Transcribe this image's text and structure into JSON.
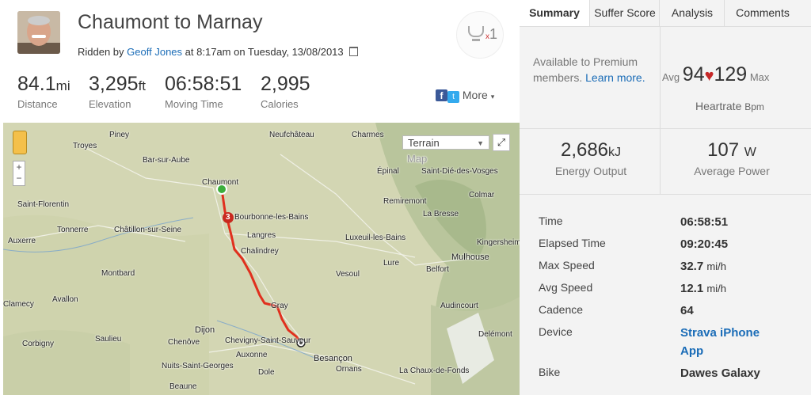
{
  "activity": {
    "title": "Chaumont to Marnay",
    "ridden_by_prefix": "Ridden by",
    "athlete": "Geoff Jones",
    "date_text": "at 8:17am on Tuesday, 13/08/2013",
    "trophy_prefix": "x",
    "trophy_count": "1"
  },
  "stats": [
    {
      "value": "84.1",
      "unit": "mi",
      "label": "Distance"
    },
    {
      "value": "3,295",
      "unit": "ft",
      "label": "Elevation"
    },
    {
      "value": "06:58:51",
      "unit": "",
      "label": "Moving Time"
    },
    {
      "value": "2,995",
      "unit": "",
      "label": "Calories"
    }
  ],
  "share": {
    "facebook": "f",
    "twitter": "t",
    "more_label": "More",
    "caret": "▾"
  },
  "map": {
    "map_type": "Terrain",
    "watermark": "Map",
    "fullscreen": "⤢",
    "zoom_in": "+",
    "zoom_out": "−",
    "marker_number": "3",
    "places": [
      {
        "name": "Piney"
      },
      {
        "name": "Neufchâteau"
      },
      {
        "name": "Charmes"
      },
      {
        "name": "Troyes"
      },
      {
        "name": "Bar-sur-Aube"
      },
      {
        "name": "Chaumont"
      },
      {
        "name": "Épinal"
      },
      {
        "name": "Saint-Dié-des-Vosges"
      },
      {
        "name": "Saint-Florentin"
      },
      {
        "name": "Bourbonne-les-Bains"
      },
      {
        "name": "Remiremont"
      },
      {
        "name": "Colmar"
      },
      {
        "name": "Tonnerre"
      },
      {
        "name": "Châtillon-sur-Seine"
      },
      {
        "name": "La Bresse"
      },
      {
        "name": "Langres"
      },
      {
        "name": "Luxeuil-les-Bains"
      },
      {
        "name": "Kingersheim"
      },
      {
        "name": "Auxerre"
      },
      {
        "name": "Chalindrey"
      },
      {
        "name": "Mulhouse"
      },
      {
        "name": "Montbard"
      },
      {
        "name": "Lure"
      },
      {
        "name": "Belfort"
      },
      {
        "name": "Vesoul"
      },
      {
        "name": "Avallon"
      },
      {
        "name": "Clamecy"
      },
      {
        "name": "Gray"
      },
      {
        "name": "Audincourt"
      },
      {
        "name": "Dijon"
      },
      {
        "name": "Saulieu"
      },
      {
        "name": "Chenôve"
      },
      {
        "name": "Corbigny"
      },
      {
        "name": "Chevigny-Saint-Sauveur"
      },
      {
        "name": "Delémont"
      },
      {
        "name": "Auxonne"
      },
      {
        "name": "Nuits-Saint-Georges"
      },
      {
        "name": "Besançon"
      },
      {
        "name": "Ornans"
      },
      {
        "name": "Dole"
      },
      {
        "name": "La Chaux-de-Fonds"
      },
      {
        "name": "Beaune"
      }
    ]
  },
  "tabs": [
    {
      "label": "Summary",
      "active": true
    },
    {
      "label": "Suffer Score",
      "active": false
    },
    {
      "label": "Analysis",
      "active": false
    },
    {
      "label": "Comments",
      "active": false
    }
  ],
  "premium": {
    "line1": "Available to Premium",
    "line2": "members.",
    "link": "Learn more."
  },
  "heartrate": {
    "avg_label": "Avg",
    "avg": "94",
    "max": "129",
    "max_label": "Max",
    "heart": "♥",
    "label": "Heartrate",
    "unit": "Bpm"
  },
  "energy": {
    "value": "2,686",
    "unit": "kJ",
    "label": "Energy Output"
  },
  "power": {
    "value": "107",
    "unit": "W",
    "label": "Average Power"
  },
  "details": [
    {
      "label": "Time",
      "value": "06:58:51",
      "unit": ""
    },
    {
      "label": "Elapsed Time",
      "value": "09:20:45",
      "unit": ""
    },
    {
      "label": "Max Speed",
      "value": "32.7",
      "unit": "mi/h"
    },
    {
      "label": "Avg Speed",
      "value": "12.1",
      "unit": "mi/h"
    },
    {
      "label": "Cadence",
      "value": "64",
      "unit": ""
    },
    {
      "label": "Device",
      "value": "Strava iPhone App",
      "unit": ""
    },
    {
      "label": "Bike",
      "value": "Dawes Galaxy",
      "unit": ""
    }
  ],
  "colors": {
    "route": "#e0301e",
    "start": "#3cae3c",
    "link": "#1a6cb7",
    "heart": "#c62828"
  }
}
